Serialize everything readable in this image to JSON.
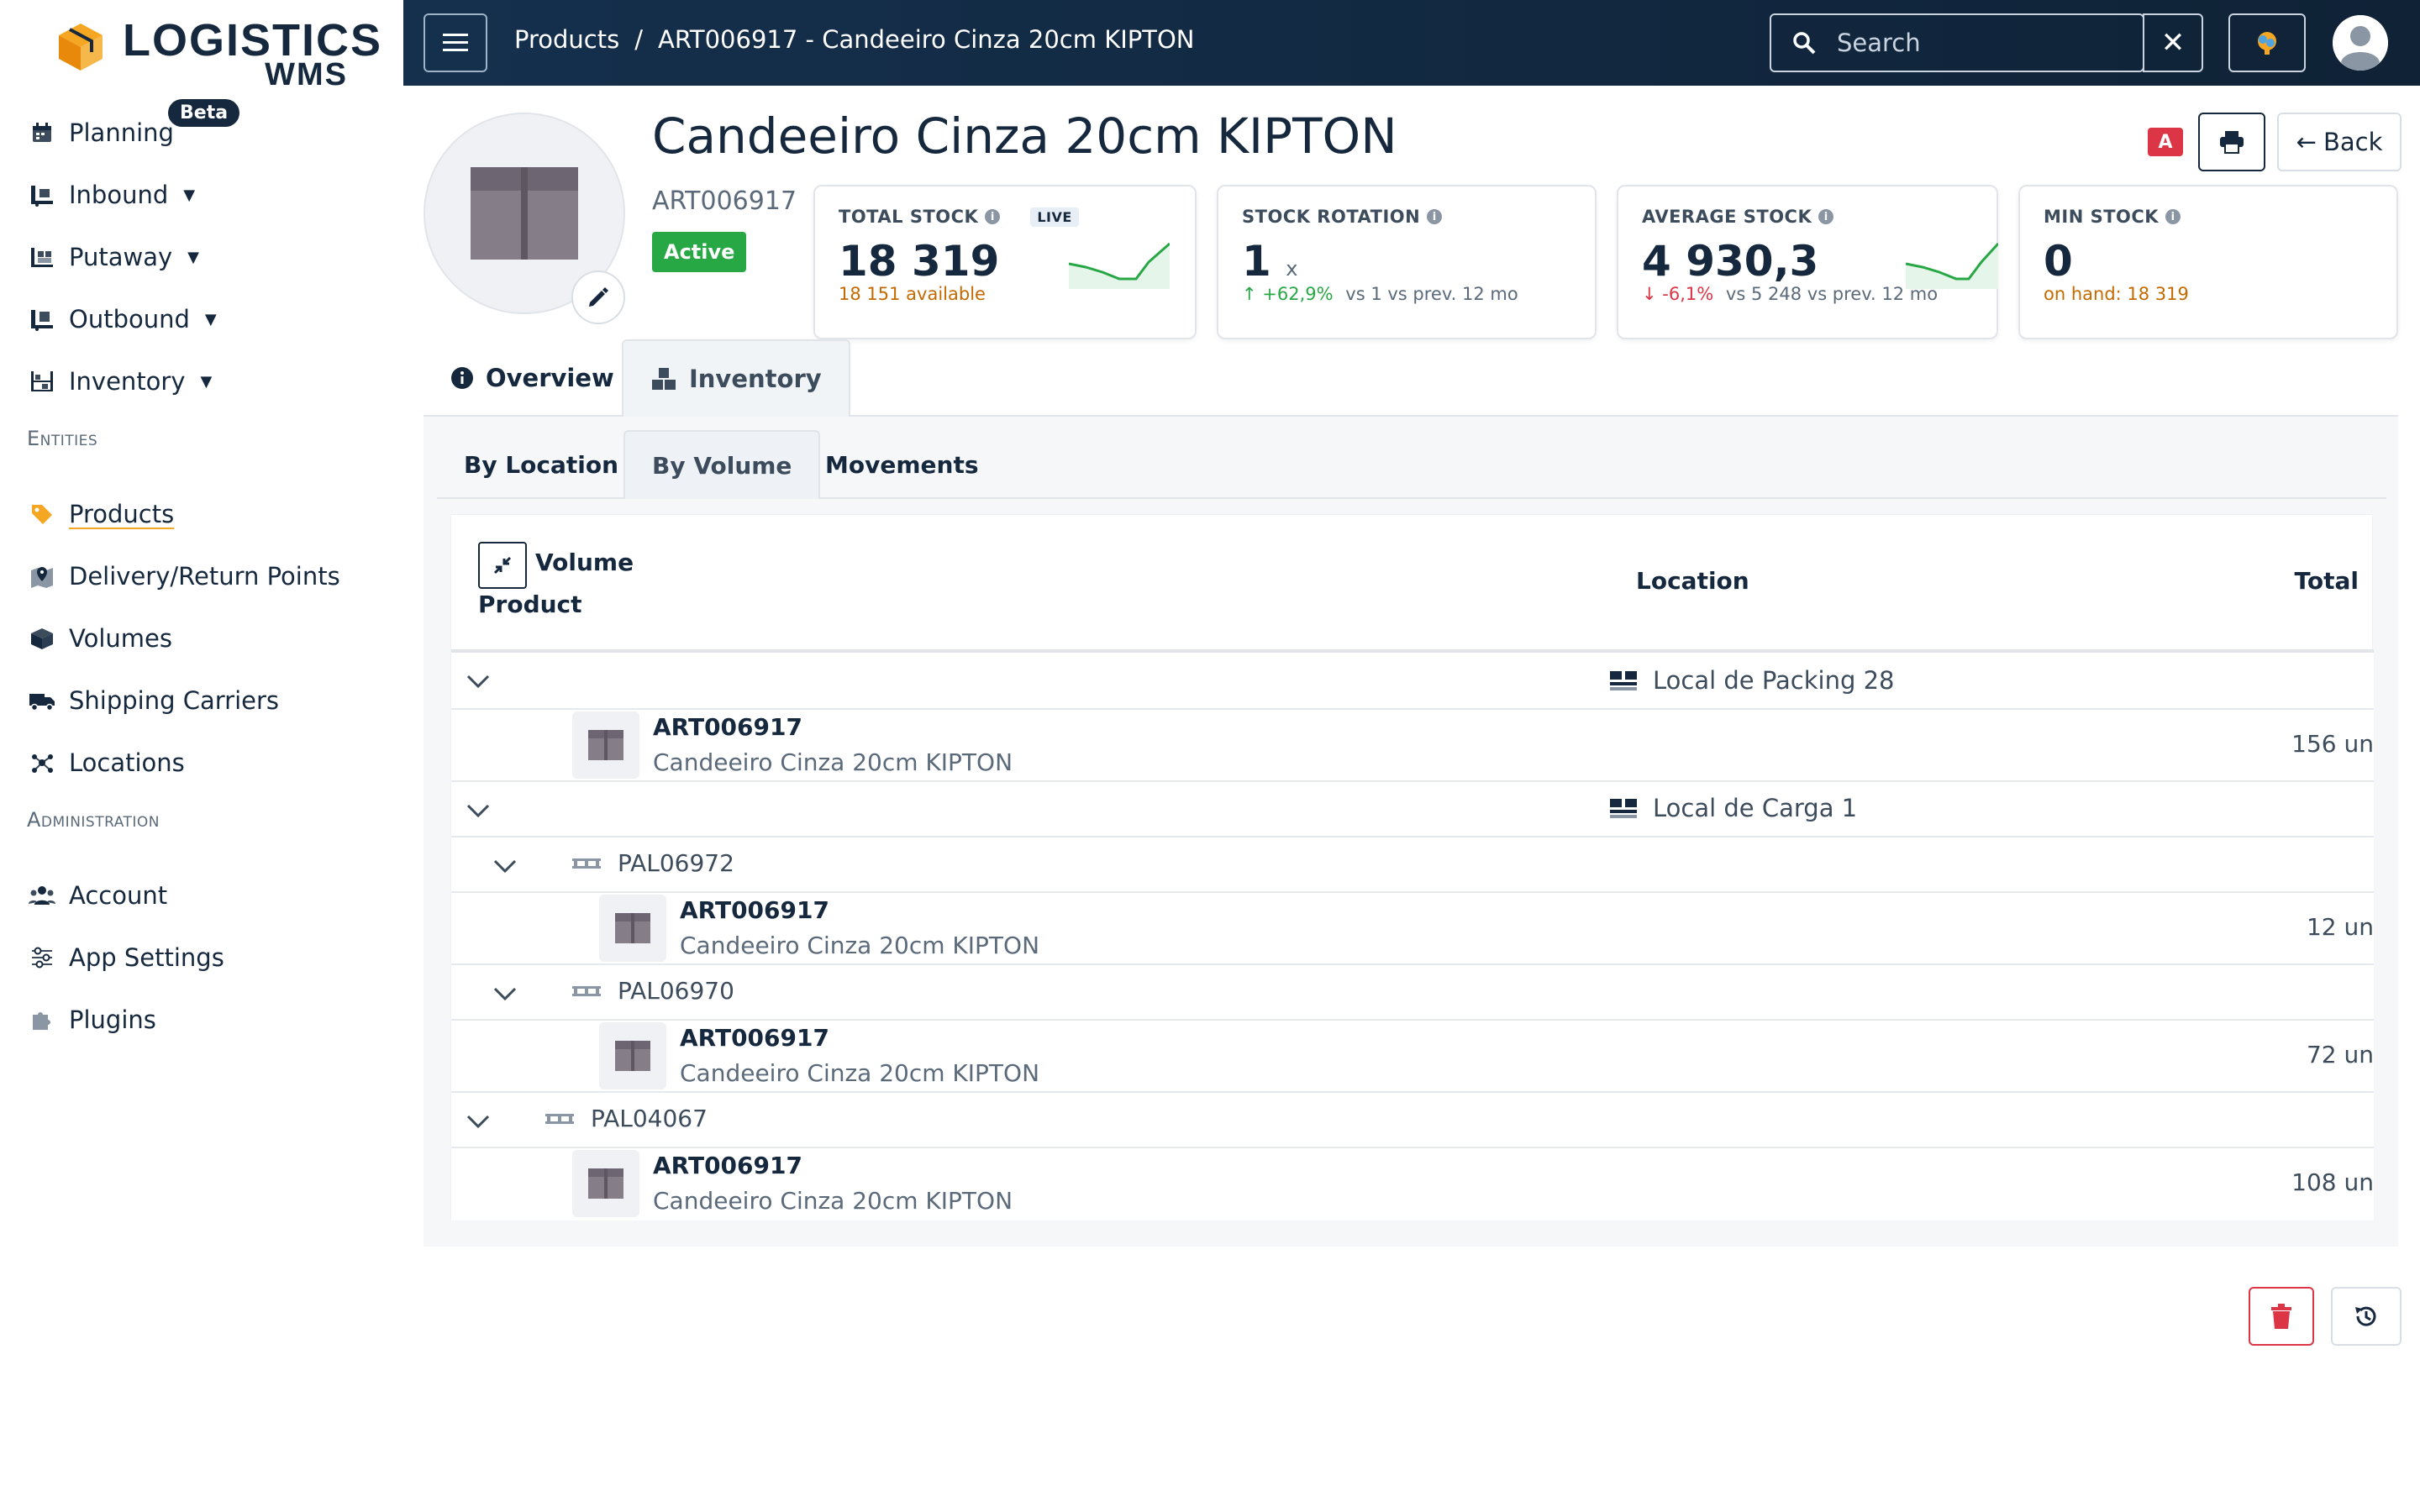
{
  "sidebar": {
    "logo": {
      "brand": "LOGISTICS",
      "sub": "WMS"
    },
    "beta_badge": "Beta",
    "items": [
      {
        "label": "Planning",
        "icon": "calendar-icon"
      },
      {
        "label": "Inbound",
        "icon": "inbound-icon"
      },
      {
        "label": "Putaway",
        "icon": "putaway-icon"
      },
      {
        "label": "Outbound",
        "icon": "outbound-icon"
      },
      {
        "label": "Inventory",
        "icon": "inventory-icon"
      }
    ],
    "section_entities": "Entities",
    "entities": [
      {
        "label": "Products",
        "icon": "tag-icon"
      },
      {
        "label": "Delivery/Return Points",
        "icon": "map-pin-icon"
      },
      {
        "label": "Volumes",
        "icon": "box-icon"
      },
      {
        "label": "Shipping Carriers",
        "icon": "truck-icon"
      },
      {
        "label": "Locations",
        "icon": "network-icon"
      }
    ],
    "section_admin": "Administration",
    "admin": [
      {
        "label": "Account",
        "icon": "users-icon"
      },
      {
        "label": "App Settings",
        "icon": "sliders-icon"
      },
      {
        "label": "Plugins",
        "icon": "puzzle-icon"
      }
    ]
  },
  "topbar": {
    "breadcrumb": {
      "parent": "Products",
      "separator": "/",
      "current": "ART006917 - Candeeiro Cinza 20cm KIPTON"
    },
    "search_placeholder": "Search"
  },
  "product": {
    "title": "Candeeiro Cinza 20cm KIPTON",
    "sku": "ART006917",
    "status": "Active",
    "abc_class": "A",
    "back_label": "Back"
  },
  "kpis": {
    "total_stock": {
      "label": "TOTAL STOCK",
      "live": "LIVE",
      "value": "18 319",
      "sub": "18 151 available"
    },
    "stock_rotation": {
      "label": "STOCK ROTATION",
      "value": "1",
      "unit": "x",
      "change": "+62,9%",
      "compare": "vs 1 vs prev. 12 mo"
    },
    "average_stock": {
      "label": "AVERAGE STOCK",
      "value": "4 930,3",
      "change": "-6,1%",
      "compare": "vs 5 248 vs prev. 12 mo"
    },
    "min_stock": {
      "label": "MIN STOCK",
      "value": "0",
      "sub": "on hand: 18 319"
    }
  },
  "tabs": {
    "overview": "Overview",
    "inventory": "Inventory"
  },
  "subtabs": {
    "by_location": "By Location",
    "by_volume": "By Volume",
    "movements": "Movements"
  },
  "grid": {
    "headers": {
      "volume": "Volume",
      "product": "Product",
      "location": "Location",
      "total": "Total"
    },
    "loc1": "Local de Packing 28",
    "loc1_item": {
      "code": "ART006917",
      "name": "Candeeiro Cinza 20cm KIPTON",
      "qty": "156 un"
    },
    "loc2": "Local de Carga 1",
    "pal1": "PAL06972",
    "pal1_item": {
      "code": "ART006917",
      "name": "Candeeiro Cinza 20cm KIPTON",
      "qty": "12 un"
    },
    "pal2": "PAL06970",
    "pal2_item": {
      "code": "ART006917",
      "name": "Candeeiro Cinza 20cm KIPTON",
      "qty": "72 un"
    },
    "pal3": "PAL04067",
    "pal3_item": {
      "code": "ART006917",
      "name": "Candeeiro Cinza 20cm KIPTON",
      "qty": "108 un"
    }
  },
  "colors": {
    "navy": "#15283d",
    "green": "#28a745",
    "red": "#dc3545",
    "orange": "#c46a00",
    "accent": "#f5a623"
  }
}
